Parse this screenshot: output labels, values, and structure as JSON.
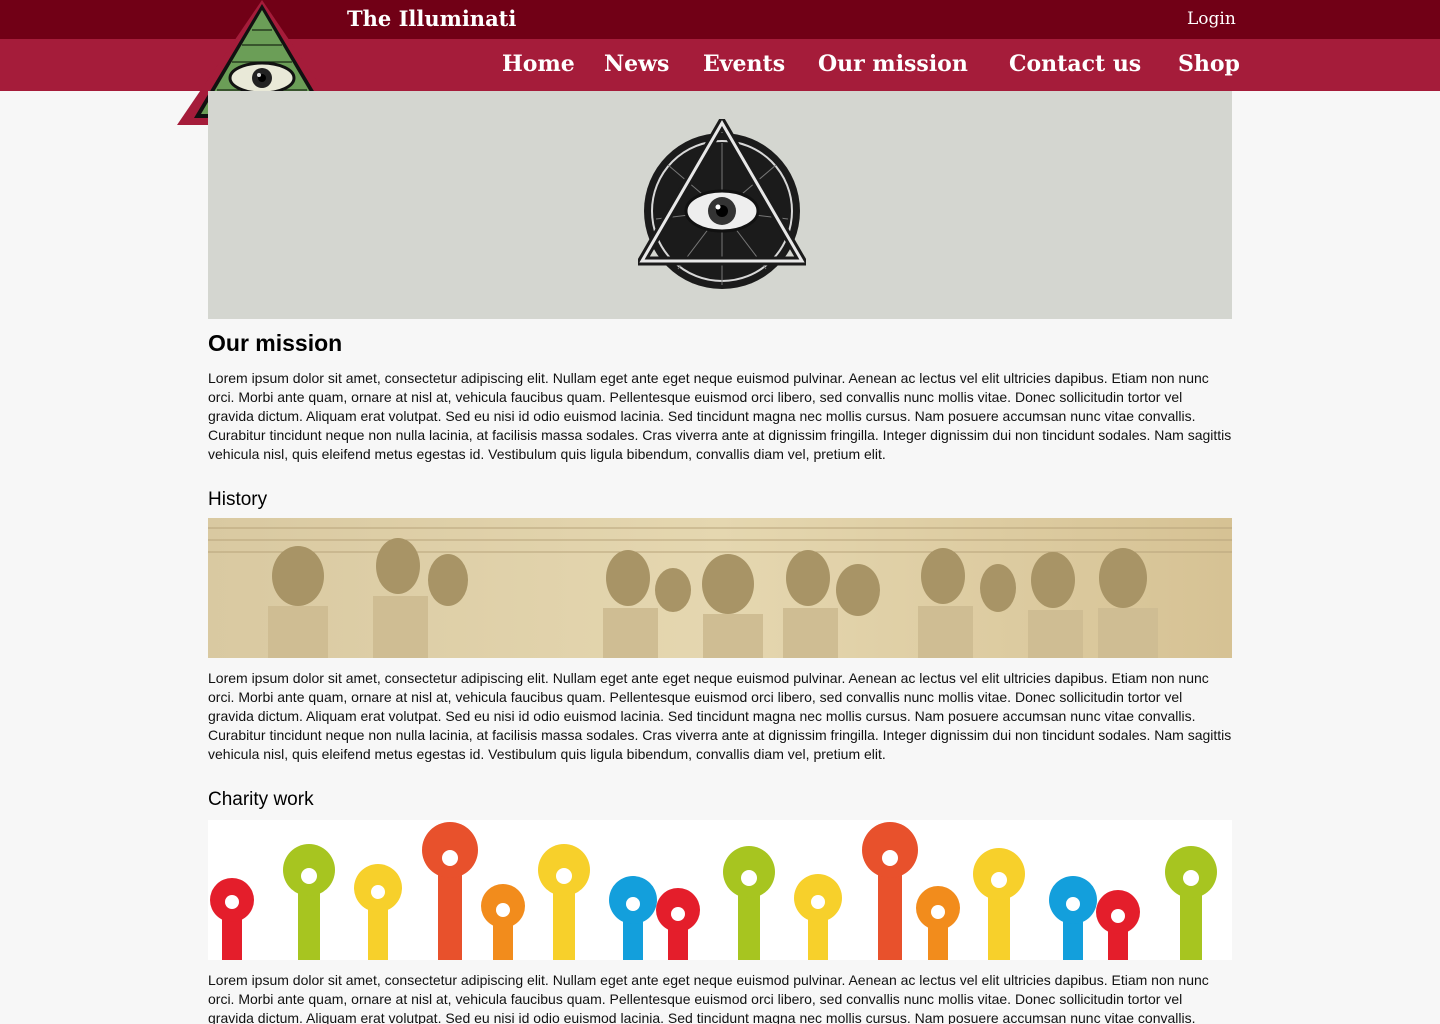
{
  "header": {
    "site_title": "The Illuminati",
    "login_label": "Login",
    "nav": [
      "Home",
      "News",
      "Events",
      "Our mission",
      "Contact us",
      "Shop"
    ]
  },
  "colors": {
    "topbar": "#710016",
    "navbar": "#a51c3a",
    "logo_green": "#6b9e57",
    "hero_bg": "#d4d6d0"
  },
  "main": {
    "title": "Our mission",
    "intro": "Lorem ipsum dolor sit amet, consectetur adipiscing elit. Nullam eget ante eget neque euismod pulvinar. Aenean ac lectus vel elit ultricies dapibus. Etiam non nunc orci. Morbi ante quam, ornare at nisl at, vehicula faucibus quam. Pellentesque euismod orci libero, sed convallis nunc mollis vitae. Donec sollicitudin tortor vel gravida dictum. Aliquam erat volutpat. Sed eu nisi id odio euismod lacinia. Sed tincidunt magna nec mollis cursus. Nam posuere accumsan nunc vitae convallis. Curabitur tincidunt neque non nulla lacinia, at facilisis massa sodales. Cras viverra ante at dignissim fringilla. Integer dignissim dui non tincidunt sodales. Nam sagittis vehicula nisl, quis eleifend metus egestas id. Vestibulum quis ligula bibendum, convallis diam vel, pretium elit.",
    "sections": [
      {
        "heading": "History",
        "text": "Lorem ipsum dolor sit amet, consectetur adipiscing elit. Nullam eget ante eget neque euismod pulvinar. Aenean ac lectus vel elit ultricies dapibus. Etiam non nunc orci. Morbi ante quam, ornare at nisl at, vehicula faucibus quam. Pellentesque euismod orci libero, sed convallis nunc mollis vitae. Donec sollicitudin tortor vel gravida dictum. Aliquam erat volutpat. Sed eu nisi id odio euismod lacinia. Sed tincidunt magna nec mollis cursus. Nam posuere accumsan nunc vitae convallis. Curabitur tincidunt neque non nulla lacinia, at facilisis massa sodales. Cras viverra ante at dignissim fringilla. Integer dignissim dui non tincidunt sodales. Nam sagittis vehicula nisl, quis eleifend metus egestas id. Vestibulum quis ligula bibendum, convallis diam vel, pretium elit."
      },
      {
        "heading": "Charity work",
        "text": "Lorem ipsum dolor sit amet, consectetur adipiscing elit. Nullam eget ante eget neque euismod pulvinar. Aenean ac lectus vel elit ultricies dapibus. Etiam non nunc orci. Morbi ante quam, ornare at nisl at, vehicula faucibus quam. Pellentesque euismod orci libero, sed convallis nunc mollis vitae. Donec sollicitudin tortor vel gravida dictum. Aliquam erat volutpat. Sed eu nisi id odio euismod lacinia. Sed tincidunt magna nec mollis cursus. Nam posuere accumsan nunc vitae convallis."
      }
    ]
  }
}
